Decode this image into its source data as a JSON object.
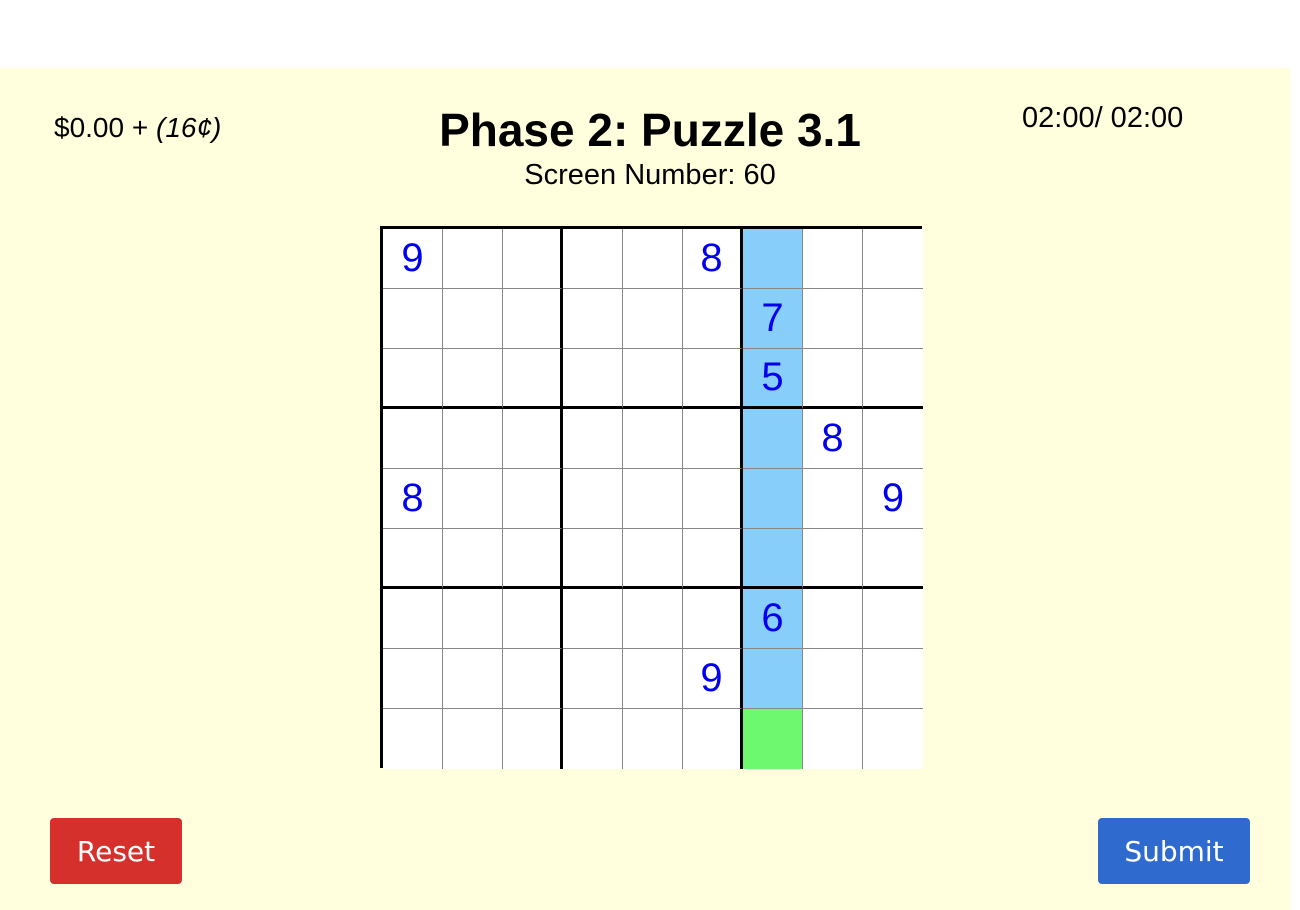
{
  "header": {
    "earnings": "$0.00",
    "earnings_separator": " + ",
    "bonus": "(16¢)",
    "title": "Phase 2: Puzzle 3.1",
    "screen_number": "Screen Number: 60",
    "timer": "02:00/ 02:00"
  },
  "colors": {
    "background": "#ffffde",
    "highlight": "#87cefa",
    "selected": "#6ef870",
    "digit": "#0000ee",
    "reset_button": "#d5302b",
    "submit_button": "#2f6bce"
  },
  "sudoku": {
    "highlighted_column": 7,
    "selected_cell": {
      "row": 9,
      "col": 7
    },
    "grid": [
      [
        "9",
        "",
        "",
        "",
        "",
        "8",
        "",
        "",
        ""
      ],
      [
        "",
        "",
        "",
        "",
        "",
        "",
        "7",
        "",
        ""
      ],
      [
        "",
        "",
        "",
        "",
        "",
        "",
        "5",
        "",
        ""
      ],
      [
        "",
        "",
        "",
        "",
        "",
        "",
        "",
        "8",
        ""
      ],
      [
        "8",
        "",
        "",
        "",
        "",
        "",
        "",
        "",
        "9"
      ],
      [
        "",
        "",
        "",
        "",
        "",
        "",
        "",
        "",
        ""
      ],
      [
        "",
        "",
        "",
        "",
        "",
        "",
        "6",
        "",
        ""
      ],
      [
        "",
        "",
        "",
        "",
        "",
        "9",
        "",
        "",
        ""
      ],
      [
        "",
        "",
        "",
        "",
        "",
        "",
        "",
        "",
        ""
      ]
    ]
  },
  "buttons": {
    "reset_label": "Reset",
    "submit_label": "Submit"
  }
}
